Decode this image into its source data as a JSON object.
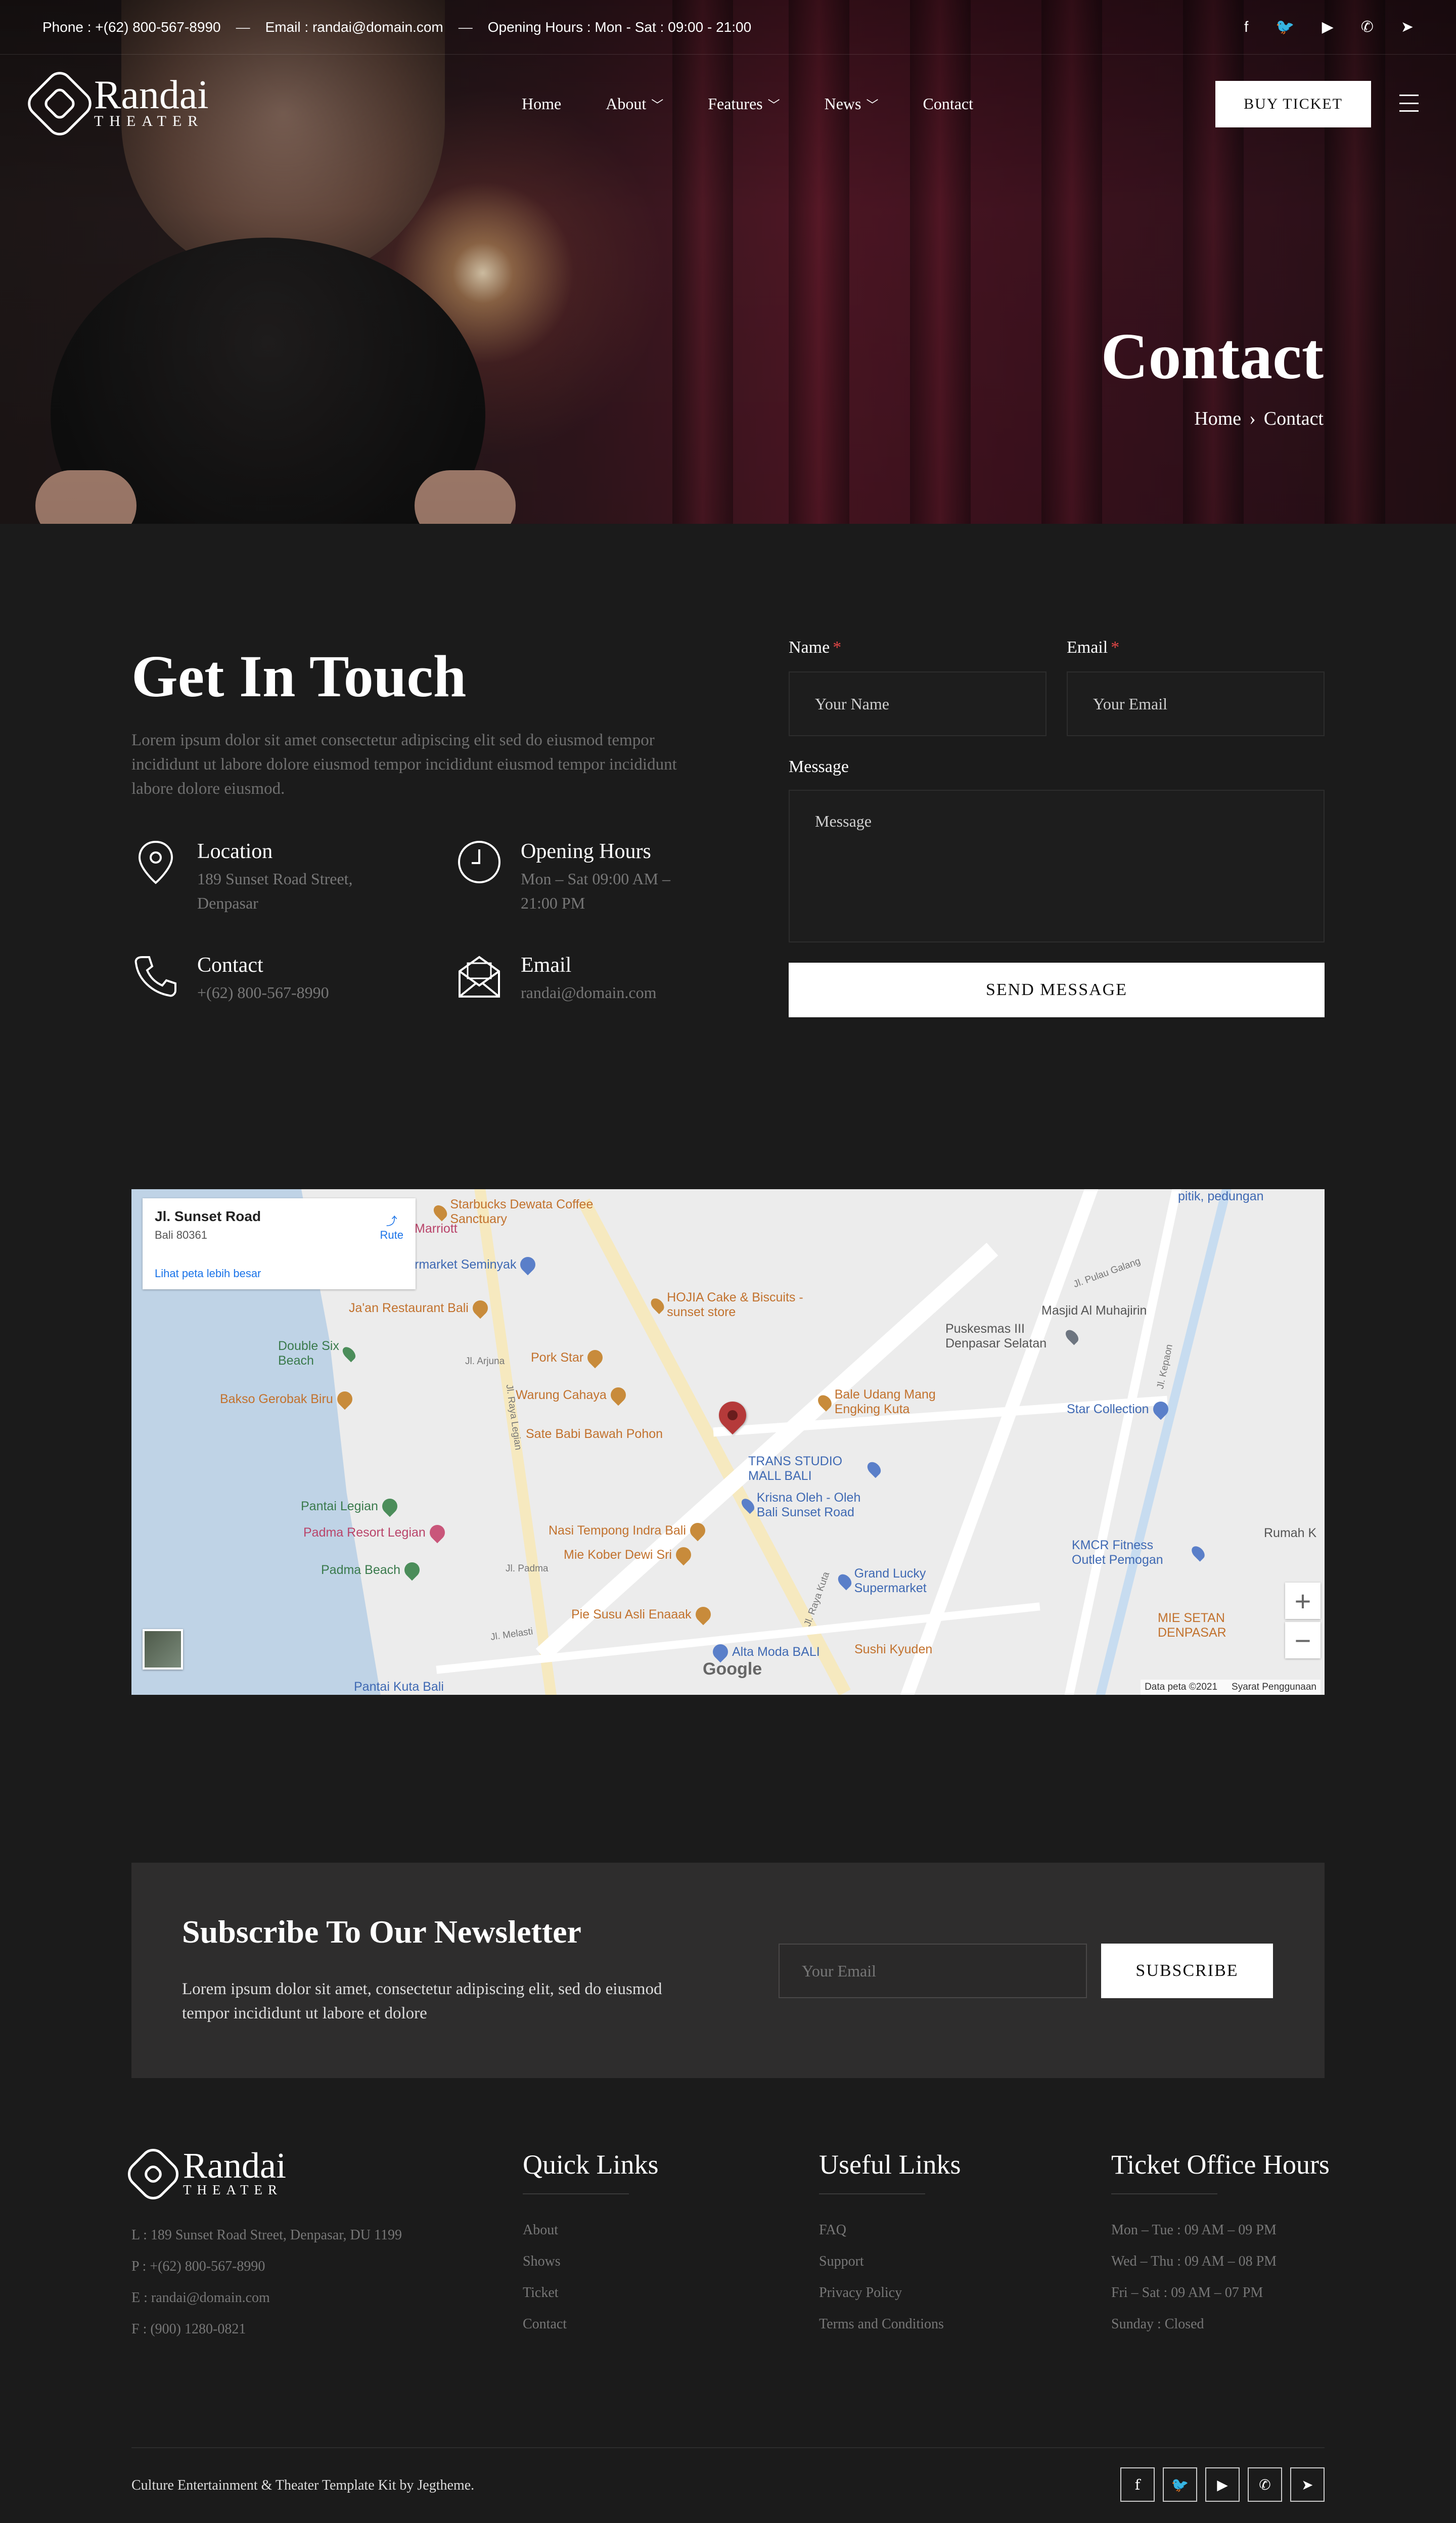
{
  "topbar": {
    "phone": "Phone : +(62) 800-567-8990",
    "email": "Email : randai@domain.com",
    "hours": "Opening Hours : Mon - Sat : 09:00 - 21:00",
    "sep": "—",
    "socials": [
      "facebook-icon",
      "twitter-icon",
      "youtube-icon",
      "whatsapp-icon",
      "telegram-icon"
    ]
  },
  "logo": {
    "name": "Randai",
    "sub": "THEATER"
  },
  "nav": {
    "items": [
      {
        "label": "Home",
        "dropdown": false
      },
      {
        "label": "About",
        "dropdown": true
      },
      {
        "label": "Features",
        "dropdown": true
      },
      {
        "label": "News",
        "dropdown": true
      },
      {
        "label": "Contact",
        "dropdown": false
      }
    ],
    "buy_ticket": "BUY TICKET"
  },
  "hero": {
    "title": "Contact",
    "breadcrumb_home": "Home",
    "breadcrumb_sep": "›",
    "breadcrumb_current": "Contact"
  },
  "contact": {
    "title": "Get In Touch",
    "description": "Lorem ipsum dolor sit amet consectetur adipiscing elit sed do eiusmod tempor incididunt ut labore dolore eiusmod tempor incididunt eiusmod tempor incididunt labore dolore eiusmod.",
    "location_title": "Location",
    "location_value": "189 Sunset Road Street, Denpasar",
    "hours_title": "Opening Hours",
    "hours_value": "Mon – Sat 09:00 AM – 21:00 PM",
    "phone_title": "Contact",
    "phone_value": "+(62) 800-567-8990",
    "email_title": "Email",
    "email_value": "randai@domain.com"
  },
  "form": {
    "name_label": "Name",
    "name_placeholder": "Your Name",
    "email_label": "Email",
    "email_placeholder": "Your Email",
    "message_label": "Message",
    "message_placeholder": "Message",
    "required_mark": "*",
    "submit": "SEND MESSAGE"
  },
  "map": {
    "place_name": "Jl. Sunset Road",
    "place_address": "Bali 80361",
    "larger_map": "Lihat peta lebih besar",
    "route": "Rute",
    "zoom_in": "+",
    "zoom_out": "−",
    "google": "Google",
    "data": "Data peta ©2021",
    "terms": "Syarat Penggunaan",
    "pois": {
      "starbucks": "Starbucks Dewata Coffee Sanctuary",
      "marriott": "Marriott",
      "seminyak": "rmarket Seminyak",
      "jaan": "Ja'an Restaurant Bali",
      "hojia": "HOJIA Cake & Biscuits - sunset store",
      "puskesmas": "Puskesmas III Denpasar Selatan",
      "masjid": "Masjid Al Muhajirin",
      "pulau": "pitik, pedungan",
      "double_six": "Double Six Beach",
      "pork_star": "Pork Star",
      "bakso": "Bakso Gerobak Biru",
      "warung": "Warung Cahaya",
      "bale": "Bale Udang Mang Engking Kuta",
      "star": "Star Collection",
      "babi": "Sate Babi Bawah Pohon",
      "trans": "TRANS STUDIO MALL BALI",
      "krisna": "Krisna Oleh - Oleh Bali Sunset Road",
      "legian": "Pantai Legian",
      "padma_resort": "Padma Resort Legian",
      "nasi": "Nasi Tempong Indra Bali",
      "mie_kober": "Mie Kober Dewi Sri",
      "padma_beach": "Padma Beach",
      "grand": "Grand Lucky Supermarket",
      "kmcr": "KMCR Fitness Outlet Pemogan",
      "rumah": "Rumah K",
      "mie_setan": "MIE SETAN DENPASAR",
      "pie": "Pie Susu Asli Enaaak",
      "alta": "Alta Moda BALI",
      "sushi": "Sushi Kyuden",
      "kuta_bali": "Pantai Kuta Bali"
    },
    "roads": {
      "legian": "Jl. Raya Legian",
      "kuta": "Jl. Raya Kuta",
      "melasti": "Jl. Melasti",
      "padma": "Jl. Padma",
      "pulau_galang": "Jl. Pulau Galang",
      "kepaon": "Jl. Kepaon",
      "arjuna": "Jl. Arjuna"
    }
  },
  "newsletter": {
    "title": "Subscribe To Our Newsletter",
    "description": "Lorem ipsum dolor sit amet, consectetur adipiscing elit, sed do eiusmod tempor incididunt ut labore et dolore",
    "placeholder": "Your Email",
    "button": "SUBSCRIBE"
  },
  "footer": {
    "address": "L : 189 Sunset Road Street, Denpasar, DU 1199",
    "phone": "P : +(62) 800-567-8990",
    "email": "E : randai@domain.com",
    "fax": "F : (900) 1280-0821",
    "quick_title": "Quick Links",
    "quick_links": [
      "About",
      "Shows",
      "Ticket",
      "Contact"
    ],
    "useful_title": "Useful Links",
    "useful_links": [
      "FAQ",
      "Support",
      "Privacy Policy",
      "Terms and Conditions"
    ],
    "hours_title": "Ticket Office Hours",
    "hours": [
      "Mon – Tue : 09 AM – 09 PM",
      "Wed – Thu : 09 AM – 08 PM",
      "Fri – Sat : 09 AM – 07 PM",
      "Sunday : Closed"
    ],
    "copyright": "Culture Entertainment & Theater Template Kit by Jegtheme.",
    "socials": [
      "facebook-icon",
      "twitter-icon",
      "youtube-icon",
      "whatsapp-icon",
      "telegram-icon"
    ]
  },
  "colors": {
    "background": "#1b1b1b",
    "card": "#2e2d2d",
    "accent": "#ffffff",
    "required": "#e04646"
  }
}
